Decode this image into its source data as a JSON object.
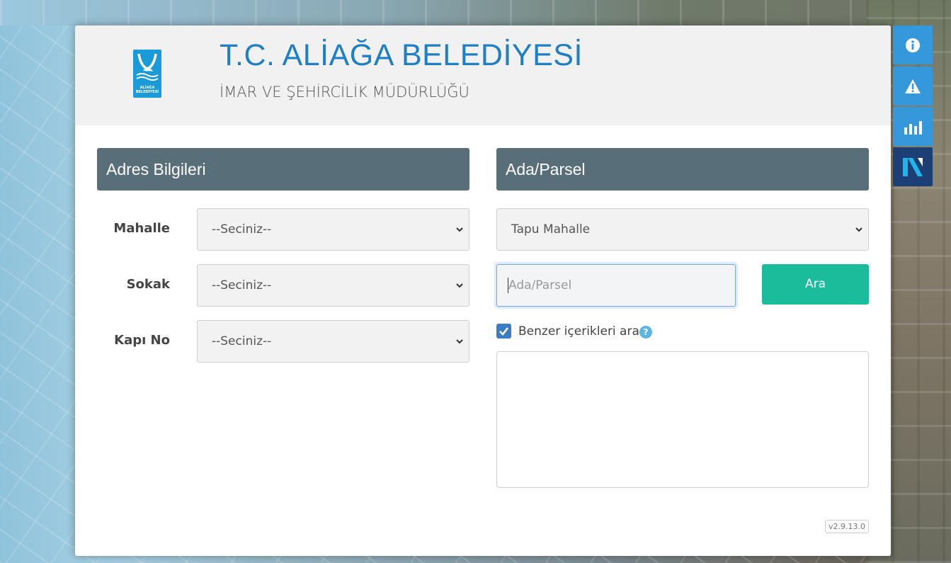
{
  "header": {
    "title": "T.C. ALİAĞA BELEDİYESİ",
    "subtitle": "İMAR VE ŞEHİRCİLİK MÜDÜRLÜĞÜ",
    "logo_text_line1": "ALİAĞA",
    "logo_text_line2": "BELEDİYESİ"
  },
  "address_panel": {
    "heading": "Adres Bilgileri",
    "fields": [
      {
        "label": "Mahalle",
        "value": "--Seciniz--"
      },
      {
        "label": "Sokak",
        "value": "--Seciniz--"
      },
      {
        "label": "Kapı No",
        "value": "--Seciniz--"
      }
    ]
  },
  "parcel_panel": {
    "heading": "Ada/Parsel",
    "tapu_select_value": "Tapu Mahalle",
    "input_placeholder": "Ada/Parsel",
    "input_value": "",
    "search_button": "Ara",
    "similar_checkbox_label": "Benzer içerikleri ara",
    "similar_checked": true,
    "help_glyph": "?"
  },
  "version": "v2.9.13.0",
  "side_toolbar": [
    {
      "icon": "info-icon"
    },
    {
      "icon": "warning-icon"
    },
    {
      "icon": "bar-chart-icon"
    },
    {
      "icon": "netcad-logo-icon"
    }
  ],
  "colors": {
    "title_blue": "#1f7fc4",
    "panel_header": "#586e78",
    "button_green": "#1abc9c",
    "side_blue": "#3498db",
    "side_dark": "#1c3f75"
  }
}
